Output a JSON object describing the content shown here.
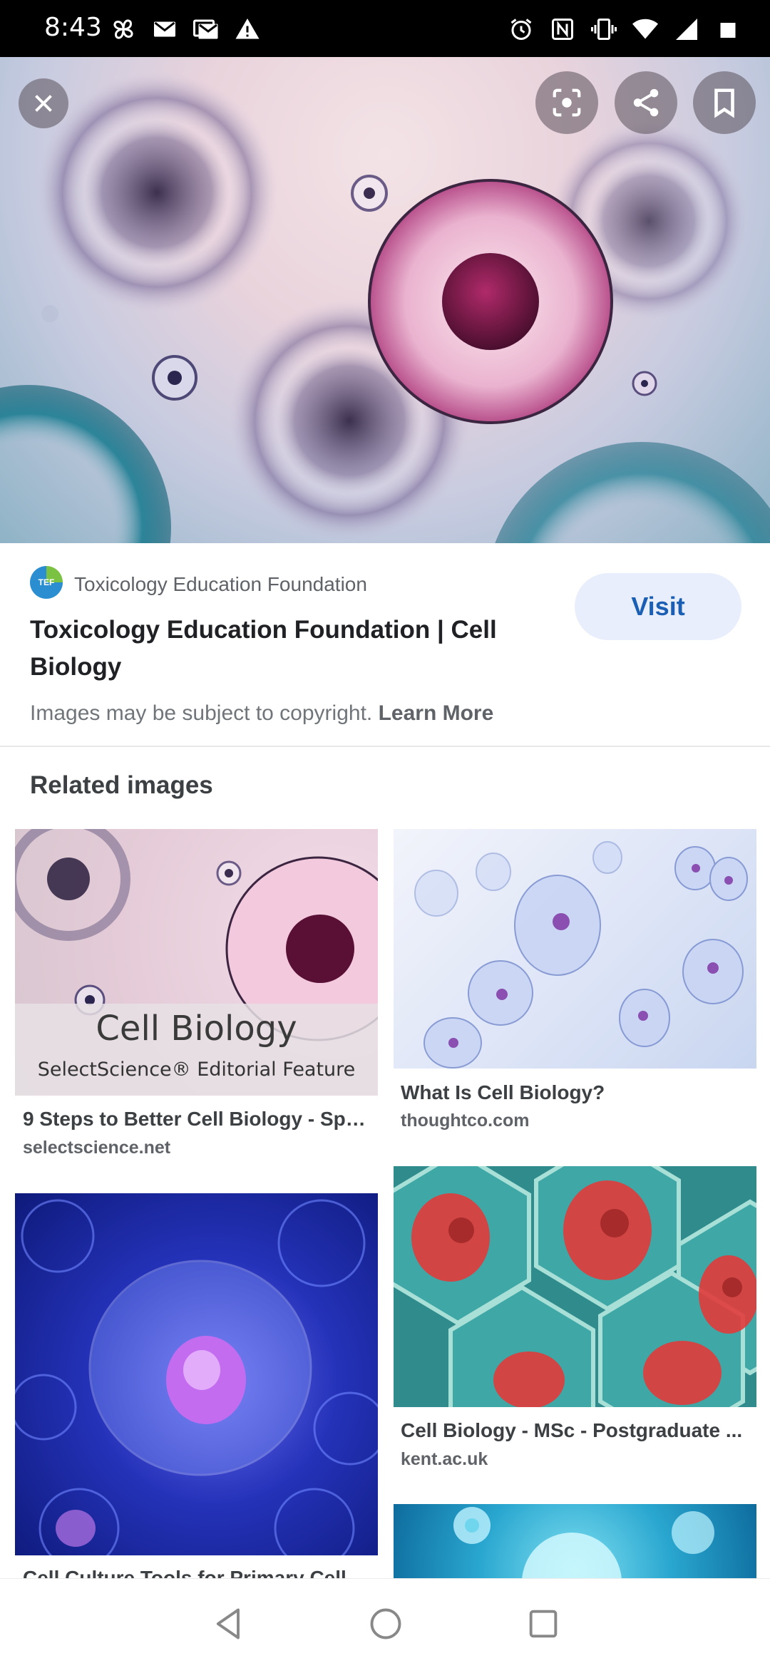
{
  "status_bar": {
    "time": "8:43",
    "left_icons": [
      "pinwheel-icon",
      "gmail-icon",
      "gmail-icon",
      "warning-icon"
    ],
    "right_icons": [
      "alarm-icon",
      "nfc-icon",
      "vibrate-icon",
      "wifi-icon",
      "signal-icon",
      "battery-icon"
    ]
  },
  "hero": {
    "actions": [
      "close-icon",
      "lens-icon",
      "share-icon",
      "bookmark-icon"
    ]
  },
  "source": {
    "logo_text": "TEF",
    "name": "Toxicology Education Foundation",
    "title": "Toxicology Education Foundation | Cell Biology",
    "visit_label": "Visit",
    "copyright_text": "Images may be subject to copyright.",
    "learn_more": "Learn More"
  },
  "related": {
    "heading": "Related images",
    "items": [
      {
        "thumb_heading": "Cell Biology",
        "thumb_sub": "SelectScience® Editorial Feature",
        "title": "9 Steps to Better Cell Biology - Spe...",
        "domain": "selectscience.net"
      },
      {
        "title": "What Is Cell Biology?",
        "domain": "thoughtco.com"
      },
      {
        "title": "Cell Culture Tools for Primary Cell ...",
        "domain": ""
      },
      {
        "title": "Cell Biology - MSc - Postgraduate ...",
        "domain": "kent.ac.uk"
      },
      {
        "title": "",
        "domain": ""
      }
    ]
  },
  "nav": {
    "buttons": [
      "back-icon",
      "home-icon",
      "recents-icon"
    ]
  }
}
